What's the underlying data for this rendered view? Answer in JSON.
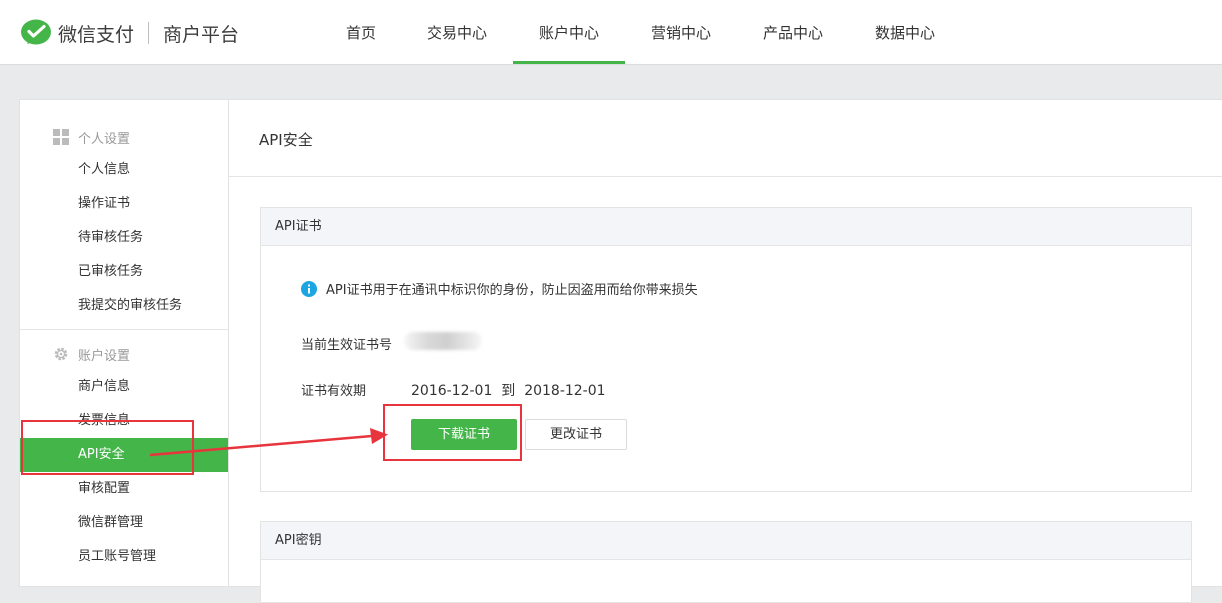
{
  "brand": {
    "name": "微信支付",
    "subtitle": "商户平台"
  },
  "nav": {
    "items": [
      "首页",
      "交易中心",
      "账户中心",
      "营销中心",
      "产品中心",
      "数据中心"
    ],
    "active_index": 2
  },
  "sidebar": {
    "groups": [
      {
        "title": "个人设置",
        "icon": "grid-icon",
        "items": [
          "个人信息",
          "操作证书",
          "待审核任务",
          "已审核任务",
          "我提交的审核任务"
        ]
      },
      {
        "title": "账户设置",
        "icon": "gear-icon",
        "items": [
          "商户信息",
          "发票信息",
          "API安全",
          "审核配置",
          "微信群管理",
          "员工账号管理"
        ]
      }
    ],
    "active_item": "API安全"
  },
  "main": {
    "title": "API安全",
    "cert_panel": {
      "title": "API证书",
      "tip": "API证书用于在通讯中标识你的身份，防止因盗用而给你带来损失",
      "current_label": "当前生效证书号",
      "validity_label": "证书有效期",
      "valid_from": "2016-12-01",
      "valid_to_word": "到",
      "valid_to": "2018-12-01",
      "download_button": "下载证书",
      "change_button": "更改证书"
    },
    "key_panel": {
      "title": "API密钥"
    }
  },
  "colors": {
    "accent": "#44b549",
    "annotation": "#e8343c",
    "info": "#1ba6e1"
  }
}
